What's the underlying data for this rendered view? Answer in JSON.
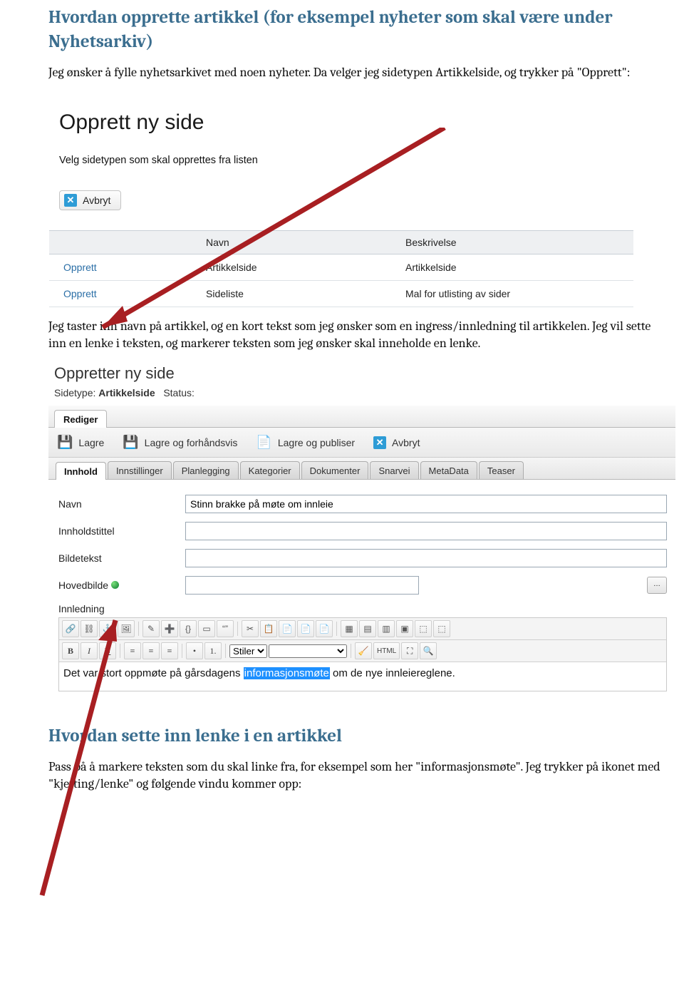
{
  "heading1": "Hvordan opprette artikkel (for eksempel nyheter som skal være under Nyhetsarkiv)",
  "para1": "Jeg ønsker å fylle nyhetsarkivet med noen nyheter. Da velger jeg sidetypen Artikkelside, og trykker på \"Opprett\":",
  "s1": {
    "title": "Opprett ny side",
    "desc": "Velg sidetypen som skal opprettes fra listen",
    "cancel": "Avbryt",
    "cols": {
      "c1": "",
      "c2": "Navn",
      "c3": "Beskrivelse"
    },
    "rows": [
      {
        "action": "Opprett",
        "name": "Artikkelside",
        "desc": "Artikkelside"
      },
      {
        "action": "Opprett",
        "name": "Sideliste",
        "desc": "Mal for utlisting av sider"
      }
    ]
  },
  "para2": "Jeg taster inn navn på artikkel, og en kort tekst som jeg ønsker som en ingress/innledning til artikkelen. Jeg vil sette inn en lenke i teksten, og markerer teksten som jeg ønsker skal inneholde en lenke.",
  "s2": {
    "titlePartial": "Oppretter ny side",
    "subtype": "Sidetype:",
    "subtypeVal": "Artikkelside",
    "statusLabel": "Status:",
    "editTab": "Rediger",
    "toolbar": {
      "save": "Lagre",
      "savePreview": "Lagre og forhåndsvis",
      "savePublish": "Lagre og publiser",
      "cancel": "Avbryt"
    },
    "subtabs": [
      "Innhold",
      "Innstillinger",
      "Planlegging",
      "Kategorier",
      "Dokumenter",
      "Snarvei",
      "MetaData",
      "Teaser"
    ],
    "fields": {
      "navn": "Navn",
      "navnVal": "Stinn brakke på møte om innleie",
      "innholdstittel": "Innholdstittel",
      "bildetekst": "Bildetekst",
      "hovedbilde": "Hovedbilde",
      "innledning": "Innledning"
    },
    "styleDropdown": "Stiler",
    "htmlBtn": "HTML",
    "editorLine": {
      "before": "Det var stort oppmøte på gårsdagens ",
      "hl": "informasjonsmøte",
      "after": " om de nye innleiereglene."
    }
  },
  "heading2": "Hvordan sette inn lenke i en artikkel",
  "para3": "Pass på å markere teksten som du skal linke fra, for eksempel som her \"informasjonsmøte\". Jeg trykker på ikonet med \"kjetting/lenke\" og følgende vindu kommer opp:"
}
